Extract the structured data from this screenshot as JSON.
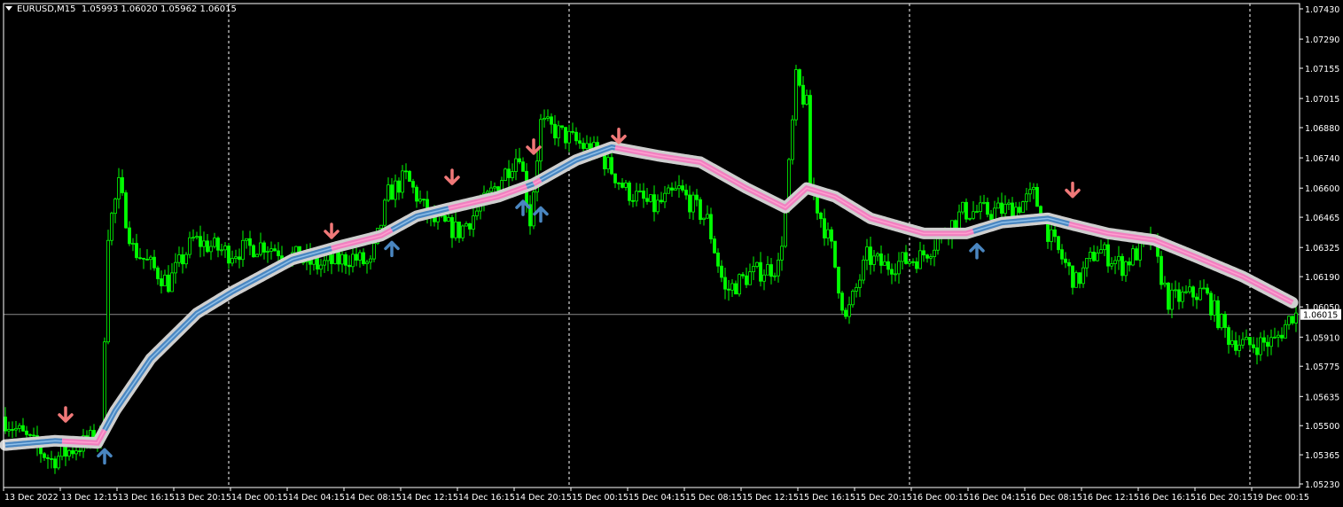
{
  "header": {
    "symbol": "EURUSD,M15",
    "open": "1.05993",
    "high": "1.06020",
    "low": "1.05962",
    "close": "1.06015"
  },
  "colors": {
    "background": "#000000",
    "candles": "#00ff00",
    "grid": "#ffffff",
    "axis_text": "#ffffff",
    "ma_up": "#4a86c0",
    "ma_down": "#f080c0",
    "ma_halo": "#cfcfcf",
    "arrow_up": "#4a86c0",
    "arrow_down": "#f07878",
    "price_line": "#8a8a8a"
  },
  "chart_data": {
    "type": "candlestick",
    "title": "EURUSD,M15",
    "ylim": [
      1.0523,
      1.0743
    ],
    "y_ticks": [
      "1.07430",
      "1.07290",
      "1.07155",
      "1.07015",
      "1.06880",
      "1.06740",
      "1.06600",
      "1.06465",
      "1.06325",
      "1.06190",
      "1.06050",
      "1.05910",
      "1.05775",
      "1.05635",
      "1.05500",
      "1.05365",
      "1.05230"
    ],
    "current_price": "1.06015",
    "bars_total": 366,
    "x_ticks": [
      "13 Dec 2022",
      "13 Dec 12:15",
      "13 Dec 16:15",
      "13 Dec 20:15",
      "14 Dec 00:15",
      "14 Dec 04:15",
      "14 Dec 08:15",
      "14 Dec 12:15",
      "14 Dec 16:15",
      "14 Dec 20:15",
      "15 Dec 00:15",
      "15 Dec 04:15",
      "15 Dec 08:15",
      "15 Dec 12:15",
      "15 Dec 16:15",
      "15 Dec 20:15",
      "16 Dec 00:15",
      "16 Dec 04:15",
      "16 Dec 08:15",
      "16 Dec 12:15",
      "16 Dec 16:15",
      "16 Dec 20:15",
      "19 Dec 00:15"
    ],
    "x_tick_bar_interval": 16,
    "day_separators_bar": [
      63,
      159,
      255,
      351
    ],
    "price_path": [
      [
        0,
        1.0554
      ],
      [
        14,
        1.0534
      ],
      [
        28,
        1.0546
      ],
      [
        30,
        1.064
      ],
      [
        33,
        1.0661
      ],
      [
        37,
        1.0632
      ],
      [
        47,
        1.0616
      ],
      [
        54,
        1.0636
      ],
      [
        64,
        1.063
      ],
      [
        74,
        1.0634
      ],
      [
        89,
        1.0624
      ],
      [
        99,
        1.0628
      ],
      [
        104,
        1.0624
      ],
      [
        109,
        1.0657
      ],
      [
        114,
        1.0665
      ],
      [
        121,
        1.0645
      ],
      [
        129,
        1.064
      ],
      [
        136,
        1.0653
      ],
      [
        146,
        1.0677
      ],
      [
        149,
        1.0645
      ],
      [
        152,
        1.069
      ],
      [
        159,
        1.0684
      ],
      [
        169,
        1.0675
      ],
      [
        176,
        1.0659
      ],
      [
        184,
        1.0651
      ],
      [
        191,
        1.0659
      ],
      [
        199,
        1.0645
      ],
      [
        204,
        1.0612
      ],
      [
        211,
        1.062
      ],
      [
        219,
        1.0624
      ],
      [
        221,
        1.0649
      ],
      [
        224,
        1.071
      ],
      [
        227,
        1.0698
      ],
      [
        228,
        1.0661
      ],
      [
        234,
        1.0632
      ],
      [
        238,
        1.0599
      ],
      [
        244,
        1.0628
      ],
      [
        249,
        1.0624
      ],
      [
        259,
        1.0628
      ],
      [
        264,
        1.0636
      ],
      [
        271,
        1.0649
      ],
      [
        279,
        1.0649
      ],
      [
        286,
        1.0651
      ],
      [
        291,
        1.0657
      ],
      [
        296,
        1.0636
      ],
      [
        303,
        1.0616
      ],
      [
        309,
        1.0632
      ],
      [
        316,
        1.0624
      ],
      [
        324,
        1.0636
      ],
      [
        329,
        1.0608
      ],
      [
        339,
        1.0612
      ],
      [
        346,
        1.0591
      ],
      [
        351,
        1.0587
      ],
      [
        359,
        1.0589
      ],
      [
        364,
        1.06015
      ]
    ],
    "ma_path": [
      [
        0,
        1.0541
      ],
      [
        14,
        1.0543
      ],
      [
        26,
        1.0542
      ],
      [
        31,
        1.0557
      ],
      [
        41,
        1.0581
      ],
      [
        54,
        1.0602
      ],
      [
        64,
        1.0612
      ],
      [
        81,
        1.0627
      ],
      [
        94,
        1.0633
      ],
      [
        106,
        1.0638
      ],
      [
        116,
        1.0647
      ],
      [
        126,
        1.0651
      ],
      [
        139,
        1.0656
      ],
      [
        149,
        1.0662
      ],
      [
        161,
        1.0673
      ],
      [
        171,
        1.0679
      ],
      [
        184,
        1.0675
      ],
      [
        196,
        1.0672
      ],
      [
        209,
        1.066
      ],
      [
        220,
        1.0651
      ],
      [
        226,
        1.066
      ],
      [
        234,
        1.0656
      ],
      [
        244,
        1.0646
      ],
      [
        259,
        1.0639
      ],
      [
        271,
        1.0639
      ],
      [
        281,
        1.0644
      ],
      [
        294,
        1.0646
      ],
      [
        301,
        1.0643
      ],
      [
        311,
        1.0639
      ],
      [
        324,
        1.0636
      ],
      [
        336,
        1.0628
      ],
      [
        349,
        1.0619
      ],
      [
        363,
        1.0607
      ]
    ],
    "ma_segments": [
      {
        "from": 0,
        "to": 16,
        "trend": "up"
      },
      {
        "from": 16,
        "to": 28,
        "trend": "down"
      },
      {
        "from": 28,
        "to": 92,
        "trend": "up"
      },
      {
        "from": 92,
        "to": 109,
        "trend": "down"
      },
      {
        "from": 109,
        "to": 125,
        "trend": "up"
      },
      {
        "from": 125,
        "to": 147,
        "trend": "down"
      },
      {
        "from": 147,
        "to": 149,
        "trend": "up"
      },
      {
        "from": 149,
        "to": 151,
        "trend": "down"
      },
      {
        "from": 151,
        "to": 172,
        "trend": "up"
      },
      {
        "from": 172,
        "to": 273,
        "trend": "down"
      },
      {
        "from": 273,
        "to": 300,
        "trend": "up"
      },
      {
        "from": 300,
        "to": 363,
        "trend": "down"
      }
    ],
    "signals": [
      {
        "bar": 17,
        "price": 1.0555,
        "type": "sell"
      },
      {
        "bar": 92,
        "price": 1.064,
        "type": "sell"
      },
      {
        "bar": 126,
        "price": 1.0665,
        "type": "sell"
      },
      {
        "bar": 149,
        "price": 1.0679,
        "type": "sell"
      },
      {
        "bar": 173,
        "price": 1.0684,
        "type": "sell"
      },
      {
        "bar": 301,
        "price": 1.0659,
        "type": "sell"
      },
      {
        "bar": 28,
        "price": 1.0536,
        "type": "buy"
      },
      {
        "bar": 109,
        "price": 1.0632,
        "type": "buy"
      },
      {
        "bar": 146,
        "price": 1.0651,
        "type": "buy"
      },
      {
        "bar": 151,
        "price": 1.0648,
        "type": "buy"
      },
      {
        "bar": 274,
        "price": 1.0631,
        "type": "buy"
      }
    ]
  }
}
